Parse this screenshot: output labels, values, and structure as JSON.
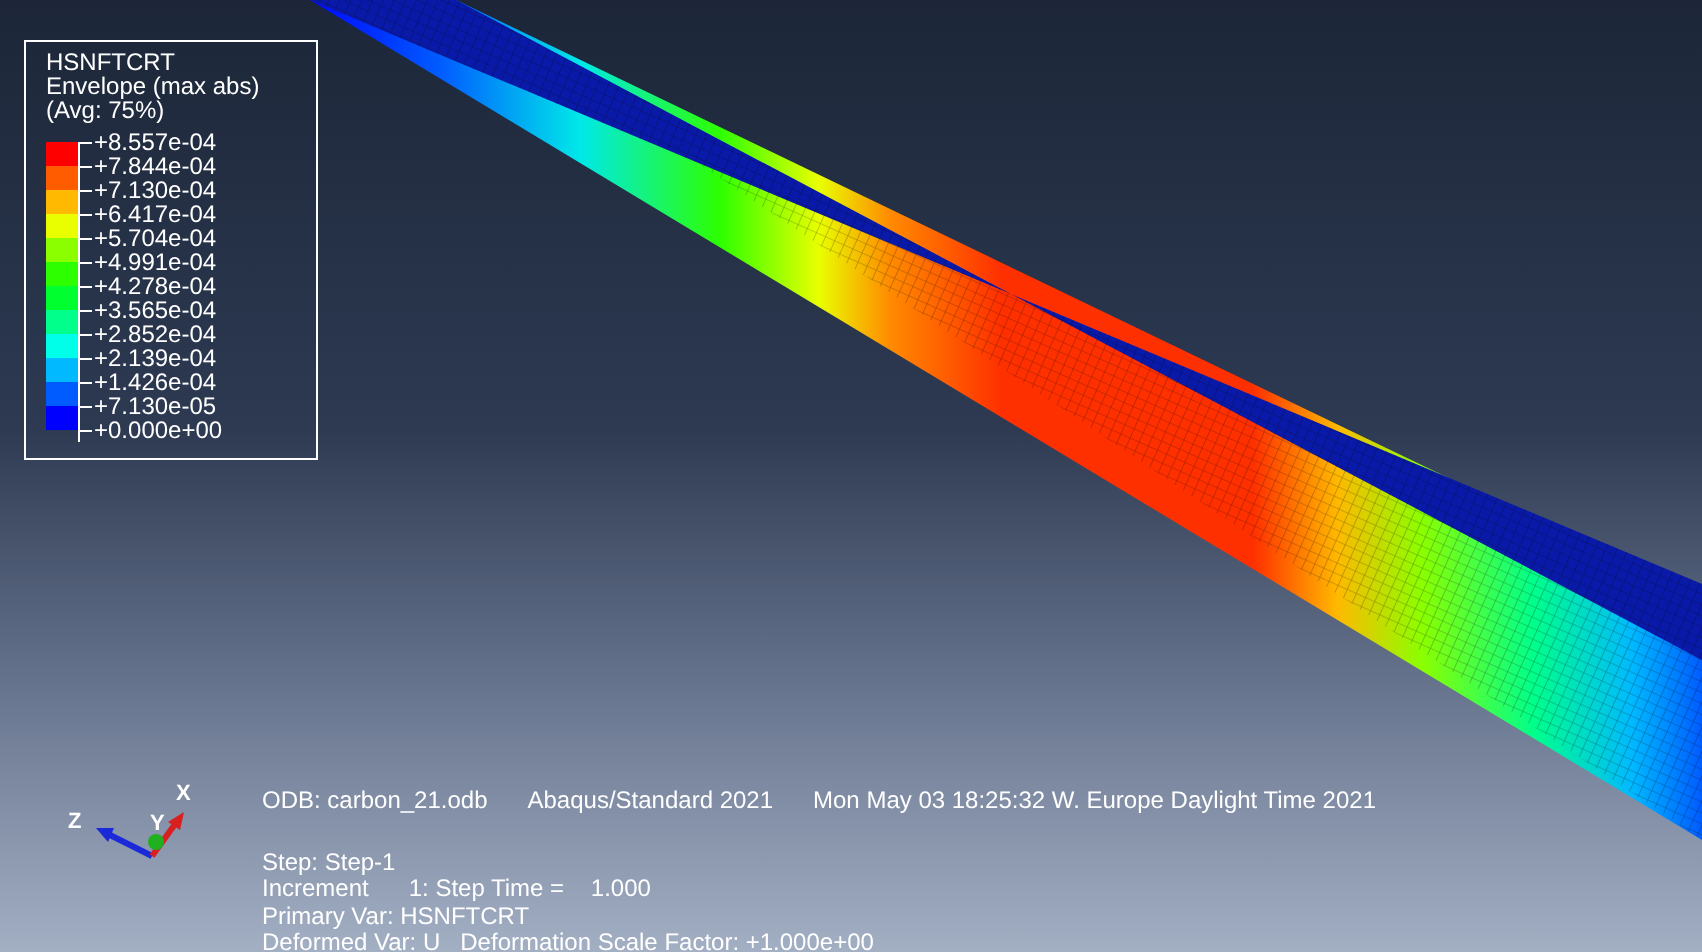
{
  "legend": {
    "title_lines": [
      "HSNFTCRT",
      "Envelope (max abs)",
      "(Avg: 75%)"
    ],
    "bands": [
      {
        "color": "#ff0000"
      },
      {
        "color": "#ff5c00"
      },
      {
        "color": "#ffb900"
      },
      {
        "color": "#e9ff00"
      },
      {
        "color": "#8bff00"
      },
      {
        "color": "#2eff00"
      },
      {
        "color": "#00ff2e"
      },
      {
        "color": "#00ff8b"
      },
      {
        "color": "#00ffe8"
      },
      {
        "color": "#00b9ff"
      },
      {
        "color": "#005cff"
      },
      {
        "color": "#0000ff"
      }
    ],
    "labels": [
      "+8.557e-04",
      "+7.844e-04",
      "+7.130e-04",
      "+6.417e-04",
      "+5.704e-04",
      "+4.991e-04",
      "+4.278e-04",
      "+3.565e-04",
      "+2.852e-04",
      "+2.139e-04",
      "+1.426e-04",
      "+7.130e-05",
      "+0.000e+00"
    ]
  },
  "triad": {
    "x": "X",
    "y": "Y",
    "z": "Z"
  },
  "info": {
    "header": [
      "ODB: carbon_21.odb",
      "Abaqus/Standard 2021",
      "Mon May 03 18:25:32 W. Europe Daylight Time 2021"
    ],
    "lines": [
      "Step: Step-1",
      "Increment      1: Step Time =    1.000",
      "Primary Var: HSNFTCRT",
      "Deformed Var: U   Deformation Scale Factor: +1.000e+00"
    ]
  }
}
